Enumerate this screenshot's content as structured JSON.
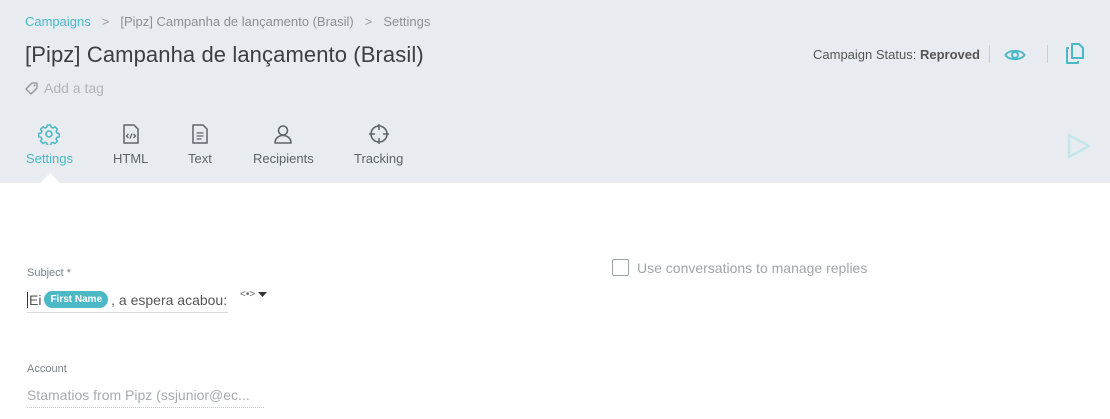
{
  "breadcrumb": {
    "items": [
      "Campaigns",
      "[Pipz] Campanha de lançamento (Brasil)",
      "Settings"
    ],
    "separator": ">"
  },
  "header": {
    "title": "[Pipz] Campanha de lançamento (Brasil)",
    "tag_placeholder": "Add a tag",
    "status_label": "Campaign Status:",
    "status_value": "Reproved"
  },
  "tabs": [
    {
      "label": "Settings",
      "icon": "gear-icon",
      "active": true
    },
    {
      "label": "HTML",
      "icon": "html-file-icon",
      "active": false
    },
    {
      "label": "Text",
      "icon": "text-file-icon",
      "active": false
    },
    {
      "label": "Recipients",
      "icon": "user-icon",
      "active": false
    },
    {
      "label": "Tracking",
      "icon": "crosshair-icon",
      "active": false
    }
  ],
  "form": {
    "subject": {
      "label": "Subject *",
      "prefix": "Ei",
      "merge_tag": "First Name",
      "suffix": ", a espera acabou:"
    },
    "merge_button_label": "<•>",
    "conversations": {
      "label": "Use conversations to manage replies",
      "checked": false
    },
    "account": {
      "label": "Account",
      "value": "Stamatios from Pipz (ssjunior@ec..."
    }
  },
  "colors": {
    "accent": "#4bb8c5",
    "header_bg": "#e8ecf0",
    "title": "#3a3f44"
  }
}
